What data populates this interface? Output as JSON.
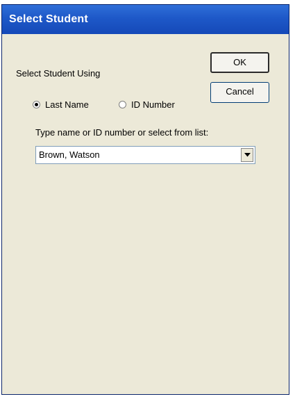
{
  "window": {
    "title": "Select Student"
  },
  "group": {
    "label": "Select Student Using"
  },
  "radios": {
    "last_name": "Last Name",
    "id_number": "ID Number",
    "selected": "last_name"
  },
  "prompt": "Type name or ID number or select from list:",
  "combo": {
    "value": "Brown, Watson"
  },
  "buttons": {
    "ok": "OK",
    "cancel": "Cancel"
  },
  "icons": {
    "combo_dropdown": "chevron-down-icon"
  },
  "colors": {
    "titlebar": "#1e58c8",
    "window_bg": "#ece9d8"
  }
}
